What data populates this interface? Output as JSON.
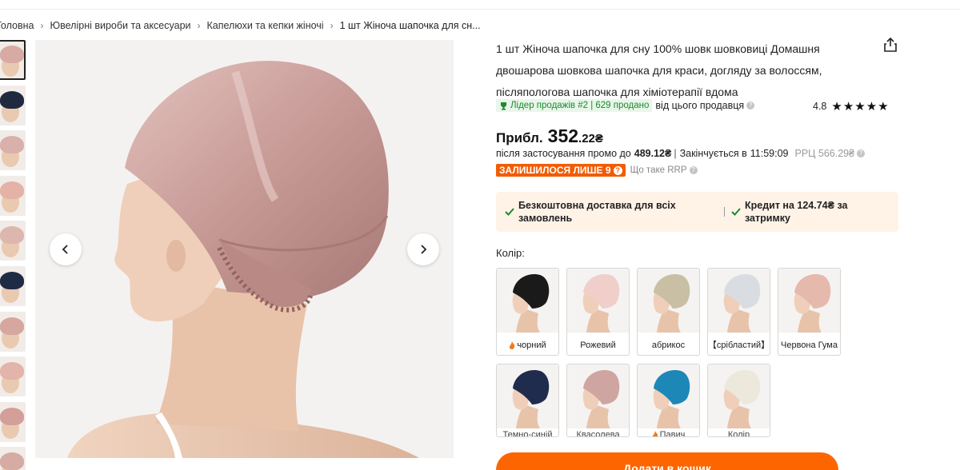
{
  "breadcrumb": {
    "items": [
      "Головна",
      "Ювелірні вироби та аксесуари",
      "Капелюхи та кепки жіночі",
      "1 шт Жіноча шапочка для сн..."
    ]
  },
  "gallery": {
    "thumbnail_cap_colors": [
      "#d8aaa4",
      "#1f2a40",
      "#d9b1aa",
      "#e4b2a7",
      "#ddb6ad",
      "#1e2b45",
      "#d5a79f",
      "#e2b4aa",
      "#d39f98",
      "#d6aba3"
    ],
    "main_cap_color": "#c99c98"
  },
  "product": {
    "title": "1 шт Жіноча шапочка для сну 100% шовк шовковиці Домашня двошарова шовкова шапочка для краси, догляду за волоссям, післяпологова шапочка для хіміотерапії вдома",
    "leader_badge": "Лідер продажів #2 | 629 продано",
    "seller_suffix": "від цього продавця",
    "rating": "4.8",
    "stars": "★★★★★"
  },
  "price": {
    "prefix": "Прибл.",
    "main": "352",
    "cents": ".22₴",
    "promo_text": "після застосування промо до",
    "promo_price": "489.12₴",
    "ends_text": "Закінчується в",
    "ends_time": "11:59:09",
    "rrp": "РРЦ 566.29₴",
    "stock_badge": "ЗАЛИШИЛОСЯ ЛИШЕ 9",
    "rrp_help": "Що таке RRP"
  },
  "benefits": {
    "free_shipping": "Безкоштовна доставка для всіх замовлень",
    "credit": "Кредит на 124.74₴ за затримку"
  },
  "colors": {
    "label": "Колір:",
    "options": [
      {
        "name": "чорний",
        "hex": "#1a1a1a",
        "hot": true
      },
      {
        "name": "Рожевий",
        "hex": "#f0cfcb",
        "hot": false
      },
      {
        "name": "абрикос",
        "hex": "#c9bfa5",
        "hot": false
      },
      {
        "name": "【срібластий】",
        "hex": "#d9dde2",
        "hot": false
      },
      {
        "name": "Червона Гума",
        "hex": "#e6b9ad",
        "hot": false
      },
      {
        "name": "Темно-синій",
        "hex": "#1f2c4d",
        "hot": false
      },
      {
        "name": "Квасолева",
        "hex": "#cfa5a1",
        "hot": false
      },
      {
        "name": "Павич",
        "hex": "#1d88b8",
        "hot": true
      },
      {
        "name": "Колір",
        "hex": "#ece9dc",
        "hot": false
      }
    ]
  },
  "cart": {
    "label": "Додати в кошик"
  }
}
